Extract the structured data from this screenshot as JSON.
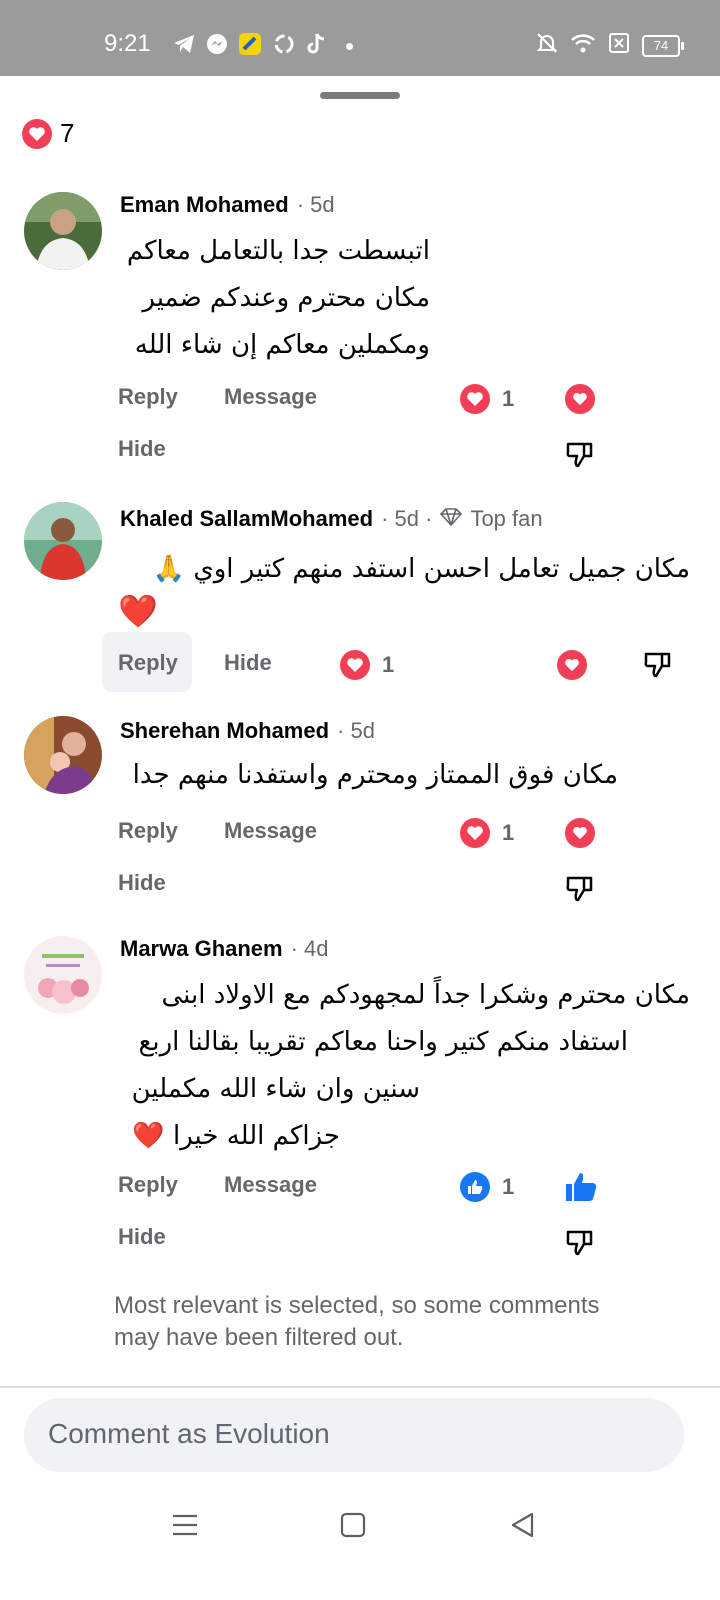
{
  "status_bar": {
    "time": "9:21",
    "battery": "74",
    "icons_left": [
      "telegram-icon",
      "messenger-icon",
      "app-icon",
      "sync-icon",
      "tiktok-icon",
      "dot-icon"
    ],
    "icons_right": [
      "mute-icon",
      "wifi-icon",
      "sim-icon",
      "battery-icon"
    ]
  },
  "post_reactions": {
    "icon": "love-icon",
    "count": "7"
  },
  "comments": [
    {
      "name": "Eman Mohamed",
      "time": "· 5d",
      "lines": [
        "اتبسطت جدا بالتعامل معاكم",
        "مكان محترم وعندكم ضمير",
        "ومكملين معاكم إن شاء الله"
      ],
      "actions": {
        "reply": "Reply",
        "message": "Message",
        "hide": "Hide"
      },
      "reaction_icon": "love-icon",
      "reaction_count": "1"
    },
    {
      "name": "Khaled SallamMohamed",
      "time": "· 5d ·",
      "badge": "Top fan",
      "lines": [
        "مكان جميل تعامل احسن استفد منهم كتير اوي 🙏"
      ],
      "trailing_emoji": "❤️",
      "actions": {
        "reply": "Reply",
        "hide": "Hide"
      },
      "reaction_icon": "love-icon",
      "reaction_count": "1"
    },
    {
      "name": "Sherehan Mohamed",
      "time": "· 5d",
      "lines": [
        "مكان فوق الممتاز ومحترم واستفدنا منهم جدا"
      ],
      "actions": {
        "reply": "Reply",
        "message": "Message",
        "hide": "Hide"
      },
      "reaction_icon": "love-icon",
      "reaction_count": "1"
    },
    {
      "name": "Marwa Ghanem",
      "time": "· 4d",
      "lines": [
        "مكان محترم وشكرا جداً لمجهودكم مع الاولاد ابنى",
        "استفاد منكم كتير واحنا معاكم تقريبا بقالنا اربع",
        "سنين وان شاء الله مكملين ",
        "جزاكم الله خيرا ❤️"
      ],
      "actions": {
        "reply": "Reply",
        "message": "Message",
        "hide": "Hide"
      },
      "reaction_icon": "like-icon",
      "reaction_count": "1"
    }
  ],
  "filter_note": "Most relevant is selected, so some comments may have been filtered out.",
  "comment_box": {
    "placeholder": "Comment as Evolution"
  },
  "nav": [
    "menu-icon",
    "home-icon",
    "back-icon"
  ],
  "colors": {
    "love": "#f33e58",
    "like": "#1877f2",
    "secondary_text": "#65676b",
    "status_bar": "#9b9b9b"
  }
}
